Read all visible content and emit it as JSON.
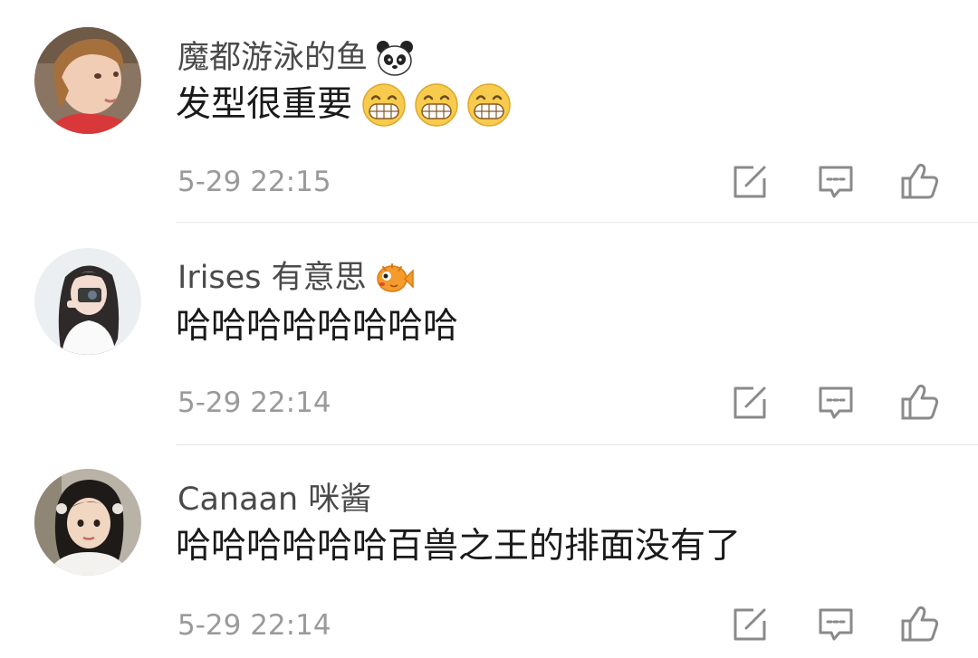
{
  "comments": [
    {
      "username": "魔都游泳的鱼",
      "badge_icon": "panda-icon",
      "text": "发型很重要",
      "emojis": [
        "grin-emoji",
        "grin-emoji",
        "grin-emoji"
      ],
      "timestamp": "5-29 22:15"
    },
    {
      "username": "Irises 有意思",
      "badge_icon": "pufferfish-icon",
      "text": "哈哈哈哈哈哈哈哈",
      "emojis": [],
      "timestamp": "5-29 22:14"
    },
    {
      "username": "Canaan 咪酱",
      "badge_icon": "",
      "text": "哈哈哈哈哈哈百兽之王的排面没有了",
      "emojis": [],
      "timestamp": "5-29 22:14"
    }
  ],
  "action_icons": [
    "repost-icon",
    "reply-icon",
    "like-icon"
  ],
  "colors": {
    "username": "#4a4a4a",
    "text": "#1a1a1a",
    "timestamp": "#9a9a9a",
    "icon": "#8a8a8a",
    "divider": "#e6e6e6"
  }
}
